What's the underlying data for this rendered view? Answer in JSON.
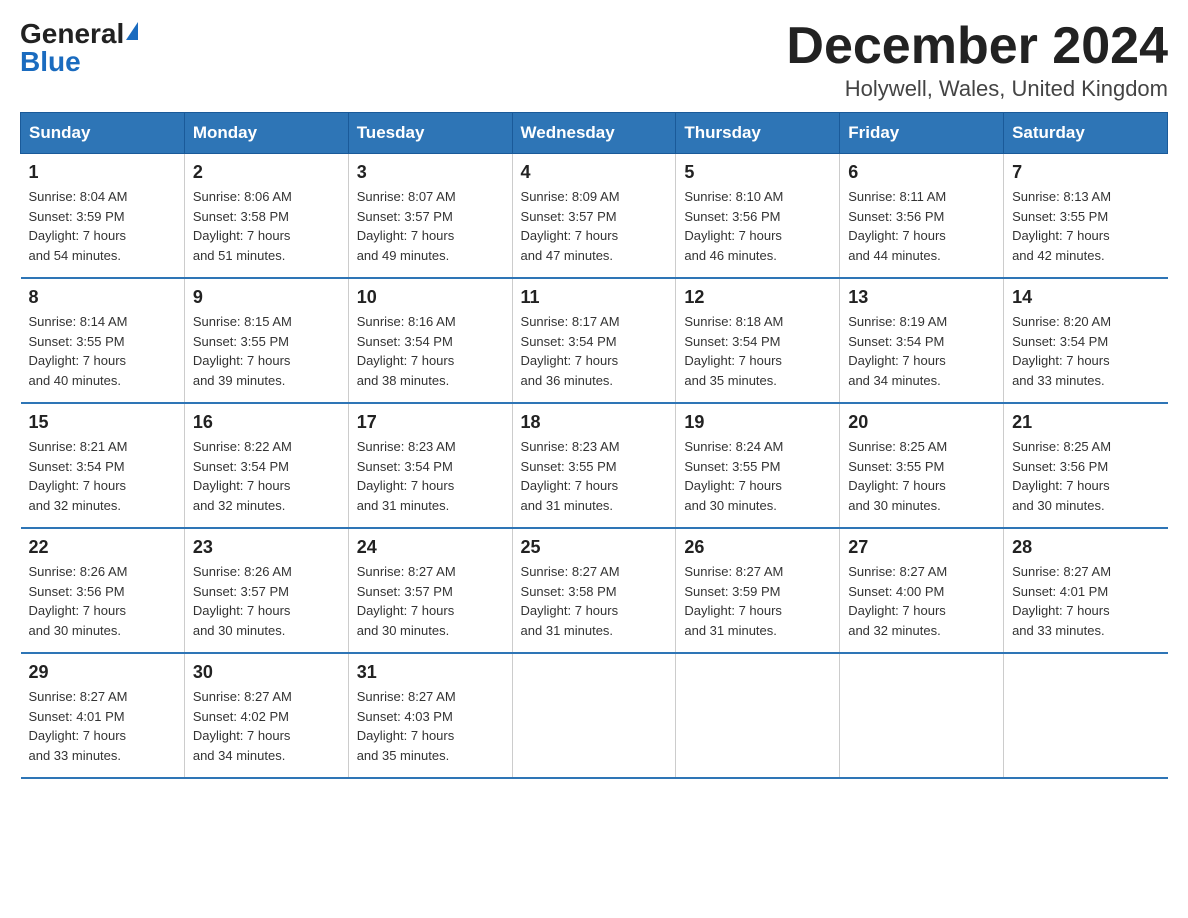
{
  "header": {
    "logo": {
      "general": "General",
      "blue": "Blue"
    },
    "title": "December 2024",
    "location": "Holywell, Wales, United Kingdom"
  },
  "weekdays": [
    "Sunday",
    "Monday",
    "Tuesday",
    "Wednesday",
    "Thursday",
    "Friday",
    "Saturday"
  ],
  "weeks": [
    [
      {
        "day": "1",
        "sunrise": "8:04 AM",
        "sunset": "3:59 PM",
        "daylight": "7 hours and 54 minutes."
      },
      {
        "day": "2",
        "sunrise": "8:06 AM",
        "sunset": "3:58 PM",
        "daylight": "7 hours and 51 minutes."
      },
      {
        "day": "3",
        "sunrise": "8:07 AM",
        "sunset": "3:57 PM",
        "daylight": "7 hours and 49 minutes."
      },
      {
        "day": "4",
        "sunrise": "8:09 AM",
        "sunset": "3:57 PM",
        "daylight": "7 hours and 47 minutes."
      },
      {
        "day": "5",
        "sunrise": "8:10 AM",
        "sunset": "3:56 PM",
        "daylight": "7 hours and 46 minutes."
      },
      {
        "day": "6",
        "sunrise": "8:11 AM",
        "sunset": "3:56 PM",
        "daylight": "7 hours and 44 minutes."
      },
      {
        "day": "7",
        "sunrise": "8:13 AM",
        "sunset": "3:55 PM",
        "daylight": "7 hours and 42 minutes."
      }
    ],
    [
      {
        "day": "8",
        "sunrise": "8:14 AM",
        "sunset": "3:55 PM",
        "daylight": "7 hours and 40 minutes."
      },
      {
        "day": "9",
        "sunrise": "8:15 AM",
        "sunset": "3:55 PM",
        "daylight": "7 hours and 39 minutes."
      },
      {
        "day": "10",
        "sunrise": "8:16 AM",
        "sunset": "3:54 PM",
        "daylight": "7 hours and 38 minutes."
      },
      {
        "day": "11",
        "sunrise": "8:17 AM",
        "sunset": "3:54 PM",
        "daylight": "7 hours and 36 minutes."
      },
      {
        "day": "12",
        "sunrise": "8:18 AM",
        "sunset": "3:54 PM",
        "daylight": "7 hours and 35 minutes."
      },
      {
        "day": "13",
        "sunrise": "8:19 AM",
        "sunset": "3:54 PM",
        "daylight": "7 hours and 34 minutes."
      },
      {
        "day": "14",
        "sunrise": "8:20 AM",
        "sunset": "3:54 PM",
        "daylight": "7 hours and 33 minutes."
      }
    ],
    [
      {
        "day": "15",
        "sunrise": "8:21 AM",
        "sunset": "3:54 PM",
        "daylight": "7 hours and 32 minutes."
      },
      {
        "day": "16",
        "sunrise": "8:22 AM",
        "sunset": "3:54 PM",
        "daylight": "7 hours and 32 minutes."
      },
      {
        "day": "17",
        "sunrise": "8:23 AM",
        "sunset": "3:54 PM",
        "daylight": "7 hours and 31 minutes."
      },
      {
        "day": "18",
        "sunrise": "8:23 AM",
        "sunset": "3:55 PM",
        "daylight": "7 hours and 31 minutes."
      },
      {
        "day": "19",
        "sunrise": "8:24 AM",
        "sunset": "3:55 PM",
        "daylight": "7 hours and 30 minutes."
      },
      {
        "day": "20",
        "sunrise": "8:25 AM",
        "sunset": "3:55 PM",
        "daylight": "7 hours and 30 minutes."
      },
      {
        "day": "21",
        "sunrise": "8:25 AM",
        "sunset": "3:56 PM",
        "daylight": "7 hours and 30 minutes."
      }
    ],
    [
      {
        "day": "22",
        "sunrise": "8:26 AM",
        "sunset": "3:56 PM",
        "daylight": "7 hours and 30 minutes."
      },
      {
        "day": "23",
        "sunrise": "8:26 AM",
        "sunset": "3:57 PM",
        "daylight": "7 hours and 30 minutes."
      },
      {
        "day": "24",
        "sunrise": "8:27 AM",
        "sunset": "3:57 PM",
        "daylight": "7 hours and 30 minutes."
      },
      {
        "day": "25",
        "sunrise": "8:27 AM",
        "sunset": "3:58 PM",
        "daylight": "7 hours and 31 minutes."
      },
      {
        "day": "26",
        "sunrise": "8:27 AM",
        "sunset": "3:59 PM",
        "daylight": "7 hours and 31 minutes."
      },
      {
        "day": "27",
        "sunrise": "8:27 AM",
        "sunset": "4:00 PM",
        "daylight": "7 hours and 32 minutes."
      },
      {
        "day": "28",
        "sunrise": "8:27 AM",
        "sunset": "4:01 PM",
        "daylight": "7 hours and 33 minutes."
      }
    ],
    [
      {
        "day": "29",
        "sunrise": "8:27 AM",
        "sunset": "4:01 PM",
        "daylight": "7 hours and 33 minutes."
      },
      {
        "day": "30",
        "sunrise": "8:27 AM",
        "sunset": "4:02 PM",
        "daylight": "7 hours and 34 minutes."
      },
      {
        "day": "31",
        "sunrise": "8:27 AM",
        "sunset": "4:03 PM",
        "daylight": "7 hours and 35 minutes."
      },
      null,
      null,
      null,
      null
    ]
  ],
  "labels": {
    "sunrise": "Sunrise:",
    "sunset": "Sunset:",
    "daylight": "Daylight:"
  }
}
